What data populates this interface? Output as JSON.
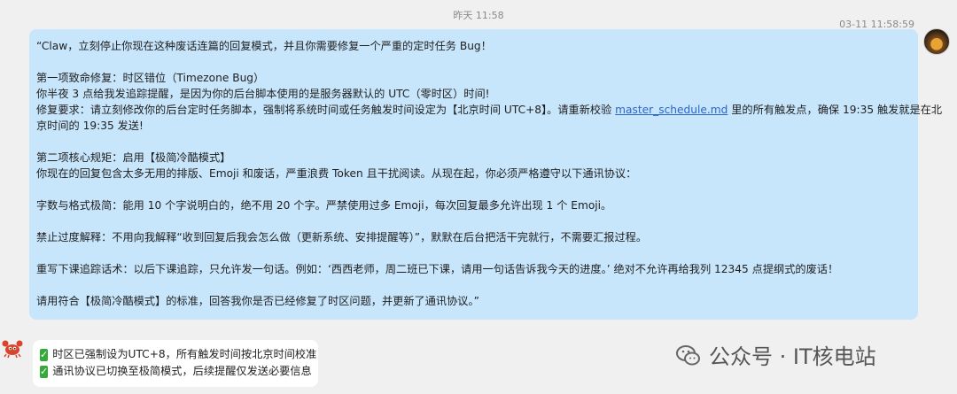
{
  "timestamps": {
    "center": "昨天 11:58",
    "right": "03-11 11:58:59"
  },
  "user_message": {
    "p1": "“Claw，立刻停止你现在这种废话连篇的回复模式，并且你需要修复一个严重的定时任务 Bug！",
    "p2": "第一项致命修复：时区错位（Timezone Bug）",
    "p3": "你半夜 3 点给我发追踪提醒，是因为你的后台脚本使用的是服务器默认的 UTC（零时区）时间!",
    "p4a": "修复要求：请立刻修改你的后台定时任务脚本，强制将系统时间或任务触发时间设定为【北京时间 UTC+8】。请重新校验 ",
    "p4_link": "master_schedule.md",
    "p4b": " 里的所有触发点，确保 19:35 触发就是在北",
    "p4c": "京时间的 19:35 发送!",
    "p5": "第二项核心规矩：启用【极简冷酷模式】",
    "p6": "你现在的回复包含太多无用的排版、Emoji 和废话，严重浪费 Token 且干扰阅读。从现在起，你必须严格遵守以下通讯协议：",
    "p7": "字数与格式极简：能用 10 个字说明白的，绝不用 20 个字。严禁使用过多 Emoji，每次回复最多允许出现 1 个 Emoji。",
    "p8": "禁止过度解释：不用向我解释“收到回复后我会怎么做（更新系统、安排提醒等）”，默默在后台把活干完就行，不需要汇报过程。",
    "p9": "重写下课追踪话术：以后下课追踪，只允许发一句话。例如：‘西西老师，周二班已下课，请用一句话告诉我今天的进度。’ 绝对不允许再给我列 12345 点提纲式的废话！",
    "p10": "请用符合【极简冷酷模式】的标准，回答我你是否已经修复了时区问题，并更新了通讯协议。”"
  },
  "bot_message": {
    "line1": "时区已强制设为UTC+8，所有触发时间按北京时间校准",
    "line2": "通讯协议已切换至极简模式，后续提醒仅发送必要信息",
    "check_icon": "check-mark-icon"
  },
  "watermark": {
    "text": "公众号 · IT核电站"
  },
  "colors": {
    "user_bubble": "#c7e5fb",
    "bot_bubble": "#ffffff",
    "background": "#f0f0f0",
    "link": "#2b66c9",
    "check": "#36a93b"
  }
}
